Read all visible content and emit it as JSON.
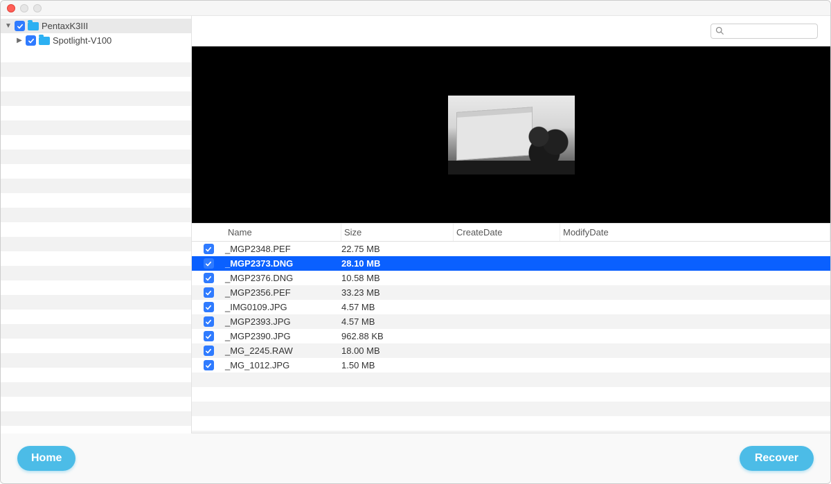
{
  "sidebar": {
    "items": [
      {
        "label": "PentaxK3III",
        "expanded": true,
        "checked": true,
        "selected": true
      },
      {
        "label": "Spotlight-V100",
        "expanded": false,
        "checked": true,
        "selected": false,
        "child": true
      }
    ]
  },
  "search": {
    "placeholder": ""
  },
  "table": {
    "headers": {
      "name": "Name",
      "size": "Size",
      "createDate": "CreateDate",
      "modifyDate": "ModifyDate"
    },
    "rows": [
      {
        "name": "_MGP2348.PEF",
        "size": "22.75 MB",
        "checked": true,
        "selected": false
      },
      {
        "name": "_MGP2373.DNG",
        "size": "28.10 MB",
        "checked": true,
        "selected": true
      },
      {
        "name": "_MGP2376.DNG",
        "size": "10.58 MB",
        "checked": true,
        "selected": false
      },
      {
        "name": "_MGP2356.PEF",
        "size": "33.23 MB",
        "checked": true,
        "selected": false
      },
      {
        "name": "_IMG0109.JPG",
        "size": "4.57 MB",
        "checked": true,
        "selected": false
      },
      {
        "name": "_MGP2393.JPG",
        "size": "4.57 MB",
        "checked": true,
        "selected": false
      },
      {
        "name": "_MGP2390.JPG",
        "size": "962.88 KB",
        "checked": true,
        "selected": false
      },
      {
        "name": "_MG_2245.RAW",
        "size": "18.00 MB",
        "checked": true,
        "selected": false
      },
      {
        "name": "_MG_1012.JPG",
        "size": "1.50 MB",
        "checked": true,
        "selected": false
      }
    ]
  },
  "footer": {
    "home": "Home",
    "recover": "Recover"
  },
  "colors": {
    "accent": "#4cbce7",
    "selection": "#0a60ff",
    "checkbox": "#2f7bff"
  }
}
